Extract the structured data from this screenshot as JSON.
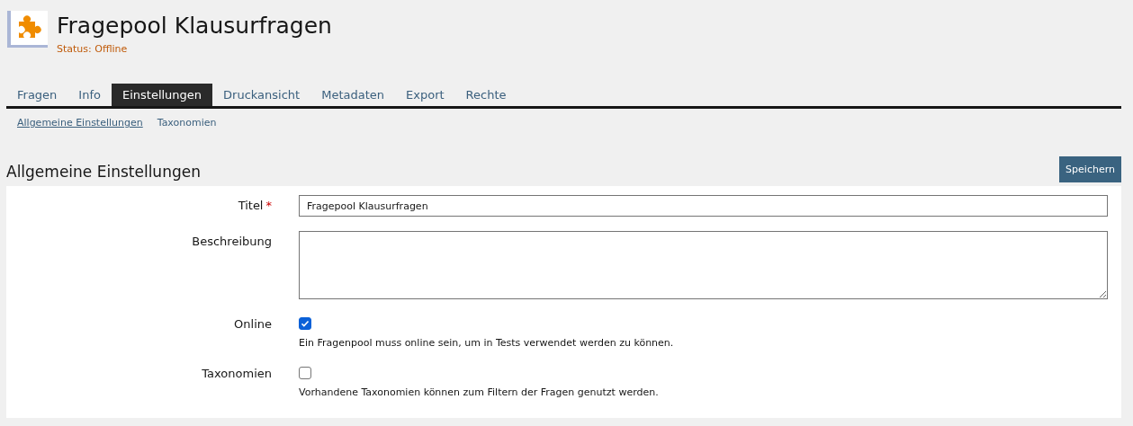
{
  "header": {
    "title": "Fragepool Klausurfragen",
    "status": "Status: Offline"
  },
  "tabs": [
    {
      "label": "Fragen",
      "selected": false
    },
    {
      "label": "Info",
      "selected": false
    },
    {
      "label": "Einstellungen",
      "selected": true
    },
    {
      "label": "Druckansicht",
      "selected": false
    },
    {
      "label": "Metadaten",
      "selected": false
    },
    {
      "label": "Export",
      "selected": false
    },
    {
      "label": "Rechte",
      "selected": false
    }
  ],
  "subtabs": [
    {
      "label": "Allgemeine Einstellungen",
      "selected": true
    },
    {
      "label": "Taxonomien",
      "selected": false
    }
  ],
  "section": {
    "title": "Allgemeine Einstellungen",
    "save_button": "Speichern"
  },
  "fields": [
    {
      "kind": "text",
      "label": "Titel",
      "required_mark": "*",
      "value": "Fragepool Klausurfragen"
    },
    {
      "kind": "textarea",
      "label": "Beschreibung"
    },
    {
      "kind": "checkbox",
      "label": "Online",
      "checked": true,
      "help": "Ein Fragenpool muss online sein, um in Tests verwendet werden zu können."
    },
    {
      "kind": "checkbox",
      "label": "Taxonomien",
      "checked": false,
      "help": "Vorhandene Taxonomien können zum Filtern der Fragen genutzt werden."
    }
  ]
}
